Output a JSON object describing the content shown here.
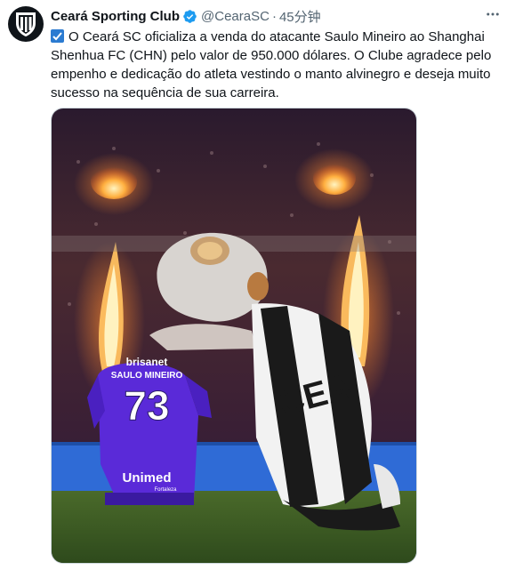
{
  "tweet": {
    "author_name": "Ceará Sporting Club",
    "handle": "@CearaSC",
    "separator": "·",
    "time": "45分钟",
    "body": "O Ceará SC oficializa a venda do atacante Saulo Mineiro ao Shanghai Shenhua FC (CHN) pelo valor de 950.000 dólares. O Clube agradece pelo empenho e dedicação do atleta vestindo o manto alvinegro e deseja muito sucesso na sequência de sua carreira."
  },
  "photo": {
    "jersey_sponsor_top": "brisanet",
    "jersey_player_name": "SAULO MINEIRO",
    "jersey_number": "73",
    "jersey_sponsor_bottom": "Unimed",
    "jersey_sponsor_small": "Fortaleza",
    "mascot_shirt_text": "CEA"
  },
  "icons": {
    "verified": "verified-badge-icon",
    "more": "more-options-icon",
    "check": "check-mark-emoji-icon"
  },
  "colors": {
    "verified_blue": "#1d9bf0",
    "text_secondary": "#536471",
    "emoji_blue": "#2b7bd1"
  }
}
